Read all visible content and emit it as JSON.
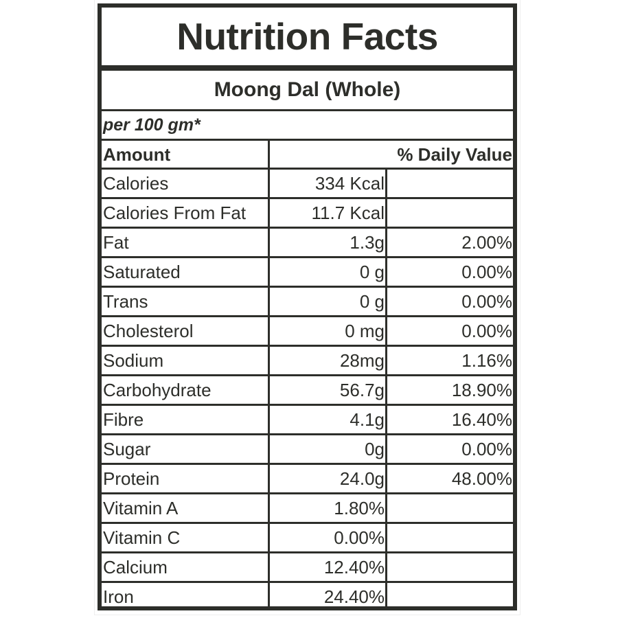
{
  "label": {
    "title": "Nutrition Facts",
    "product": "Moong Dal (Whole)",
    "serving": "per 100 gm*",
    "header": {
      "amount": "Amount",
      "daily_value": "% Daily Value"
    },
    "rows": [
      {
        "name": "Calories",
        "amount": "334 Kcal",
        "daily_value": ""
      },
      {
        "name": "Calories From Fat",
        "amount": "11.7 Kcal",
        "daily_value": ""
      },
      {
        "name": "Fat",
        "amount": "1.3g",
        "daily_value": "2.00%"
      },
      {
        "name": "Saturated",
        "amount": "0 g",
        "daily_value": "0.00%"
      },
      {
        "name": "Trans",
        "amount": "0 g",
        "daily_value": "0.00%"
      },
      {
        "name": "Cholesterol",
        "amount": "0 mg",
        "daily_value": "0.00%"
      },
      {
        "name": "Sodium",
        "amount": "28mg",
        "daily_value": "1.16%"
      },
      {
        "name": "Carbohydrate",
        "amount": "56.7g",
        "daily_value": "18.90%"
      },
      {
        "name": "Fibre",
        "amount": "4.1g",
        "daily_value": "16.40%"
      },
      {
        "name": "Sugar",
        "amount": "0g",
        "daily_value": "0.00%"
      },
      {
        "name": "Protein",
        "amount": "24.0g",
        "daily_value": "48.00%"
      },
      {
        "name": "Vitamin A",
        "amount": "1.80%",
        "daily_value": ""
      },
      {
        "name": "Vitamin C",
        "amount": "0.00%",
        "daily_value": ""
      },
      {
        "name": "Calcium",
        "amount": "12.40%",
        "daily_value": ""
      },
      {
        "name": "Iron",
        "amount": "24.40%",
        "daily_value": ""
      }
    ]
  },
  "colors": {
    "ink": "#2d2e2a",
    "background": "#ffffff"
  }
}
